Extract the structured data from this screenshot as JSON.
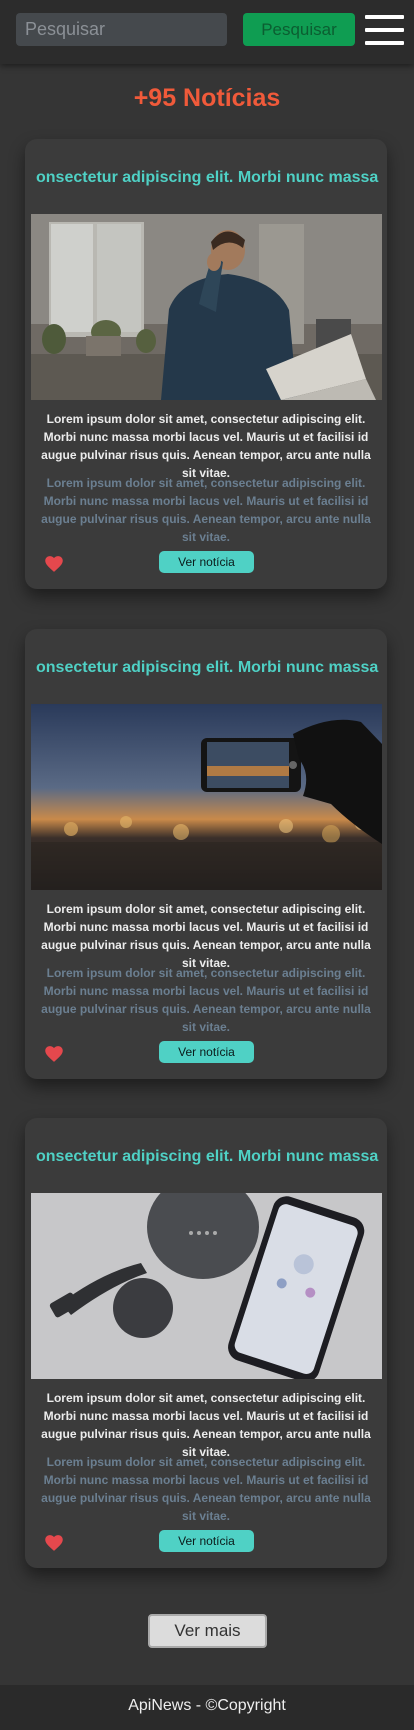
{
  "header": {
    "search_placeholder": "Pesquisar",
    "search_button": "Pesquisar",
    "menu_icon": "hamburger-menu-icon"
  },
  "headline": "+95 Notícias",
  "cards": [
    {
      "title": "onsectetur adipiscing elit. Morbi nunc massa",
      "image": "man-on-phone-with-laptop-photo",
      "text": "Lorem ipsum dolor sit amet, consectetur adipiscing elit. Morbi nunc massa morbi lacus vel. Mauris ut et facilisi id augue pulvinar risus quis. Aenean tempor, arcu ante nulla sit vitae.",
      "text_secondary": "Lorem ipsum dolor sit amet, consectetur adipiscing elit. Morbi nunc massa morbi lacus vel. Mauris ut et facilisi id augue pulvinar risus quis. Aenean tempor, arcu ante nulla sit vitae.",
      "button": "Ver notícia"
    },
    {
      "title": "onsectetur adipiscing elit. Morbi nunc massa",
      "image": "phone-photographing-sunset-photo",
      "text": "Lorem ipsum dolor sit amet, consectetur adipiscing elit. Morbi nunc massa morbi lacus vel. Mauris ut et facilisi id augue pulvinar risus quis. Aenean tempor, arcu ante nulla sit vitae.",
      "text_secondary": "Lorem ipsum dolor sit amet, consectetur adipiscing elit. Morbi nunc massa morbi lacus vel. Mauris ut et facilisi id augue pulvinar risus quis. Aenean tempor, arcu ante nulla sit vitae.",
      "button": "Ver notícia"
    },
    {
      "title": "onsectetur adipiscing elit. Morbi nunc massa",
      "image": "smart-speaker-chromecast-phone-photo",
      "text": "Lorem ipsum dolor sit amet, consectetur adipiscing elit. Morbi nunc massa morbi lacus vel. Mauris ut et facilisi id augue pulvinar risus quis. Aenean tempor, arcu ante nulla sit vitae.",
      "text_secondary": "Lorem ipsum dolor sit amet, consectetur adipiscing elit. Morbi nunc massa morbi lacus vel. Mauris ut et facilisi id augue pulvinar risus quis. Aenean tempor, arcu ante nulla sit vitae.",
      "button": "Ver notícia"
    }
  ],
  "more_button": "Ver mais",
  "footer": "ApiNews - ©Copyright",
  "colors": {
    "accent": "#4fd1c5",
    "headline": "#f05a3a",
    "search_button": "#0f9d52",
    "like": "#e5484d",
    "background": "#353535"
  }
}
